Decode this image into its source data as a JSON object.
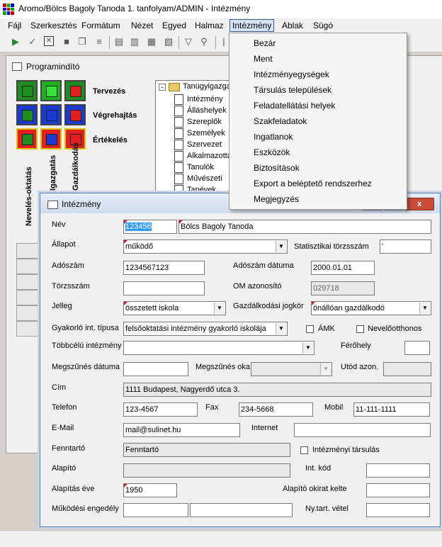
{
  "window": {
    "title": "Aromo/Bölcs Bagoly Tanoda 1. tanfolyam/ADMIN - Intézmény"
  },
  "menubar": [
    "Fájl",
    "Szerkesztés",
    "Formátum",
    "Nézet",
    "Egyed",
    "Halmaz",
    "Intézmény",
    "Ablak",
    "Súgó"
  ],
  "dropdown": {
    "items": [
      "Bezár",
      "Ment",
      "Intézményegységek",
      "Társulás települések",
      "Feladatellátási helyek",
      "Szakfeladatok",
      "Ingatlanok",
      "Eszközök",
      "Biztosítások",
      "Export a beléptető rendszerhez",
      "Megjegyzés"
    ]
  },
  "launcher": {
    "title": "Programindító",
    "rows": [
      "Tervezés",
      "Végrehajtás",
      "Értékelés"
    ],
    "vertical": [
      "Nevelés-oktatás",
      "Igazgatás",
      "Gazdálkodás"
    ],
    "tree_root": "Tanügyigazgatás",
    "tree_items": [
      "Intézmény",
      "Álláshelyek",
      "Szereplők",
      "Személyek",
      "Szervezet",
      "Alkalmazottak",
      "Tanulók",
      "Művészeti",
      "Tanévek"
    ]
  },
  "dialog": {
    "title": "Intézmény",
    "close_glyph": "x",
    "labels": {
      "nev": "Név",
      "allapot": "Állapot",
      "stat": "Statisztikai törzsszám",
      "adoszam": "Adószám",
      "adoszam_datuma": "Adószám dátuma",
      "torzsszam": "Törzsszám",
      "om": "OM azonosító",
      "jelleg": "Jelleg",
      "gazd": "Gazdálkodási jogkör",
      "gyak": "Gyakorló int. típusa",
      "amk": "ÁMK",
      "nevelo": "Nevelőotthonos",
      "tobbcelu": "Többcélú intézmény",
      "ferohely": "Férőhely",
      "megszunes_datuma": "Megszűnés dátuma",
      "megszunes_oka": "Megszűnés oka",
      "utod": "Utód azon.",
      "cim": "Cím",
      "telefon": "Telefon",
      "fax": "Fax",
      "mobil": "Mobil",
      "email": "E-Mail",
      "internet": "Internet",
      "fenntarto": "Fenntartó",
      "int_tarsulas": "Intézményi társulás",
      "alapito": "Alapító",
      "int_kod": "Int. kód",
      "alapitas_eve": "Alapítás éve",
      "alapito_okirat": "Alapító okirat kelte",
      "mukodesi": "Működési engedély",
      "nytart": "Ny.tart. vétel"
    },
    "values": {
      "nev_kod": "123456",
      "nev": "Bölcs Bagoly Tanoda",
      "allapot": "működő",
      "stat": "'",
      "adoszam": "1234567123",
      "adoszam_datuma": "2000.01.01",
      "torzsszam": "",
      "om": "029718",
      "jelleg": "összetett iskola",
      "gazd": "önállóan gazdálkodó",
      "gyak": "felsőoktatási intézmény gyakorló iskolája",
      "tobbcelu": "",
      "ferohely": "",
      "cim": "1111 Budapest, Nagyerdő utca 3.",
      "telefon": "123-4567",
      "fax": "234-5668",
      "mobil": "11-111-1111",
      "email": "mail@sulinet.hu",
      "internet": "",
      "fenntarto": "Fenntartó",
      "alapitas_eve": "1950"
    }
  }
}
